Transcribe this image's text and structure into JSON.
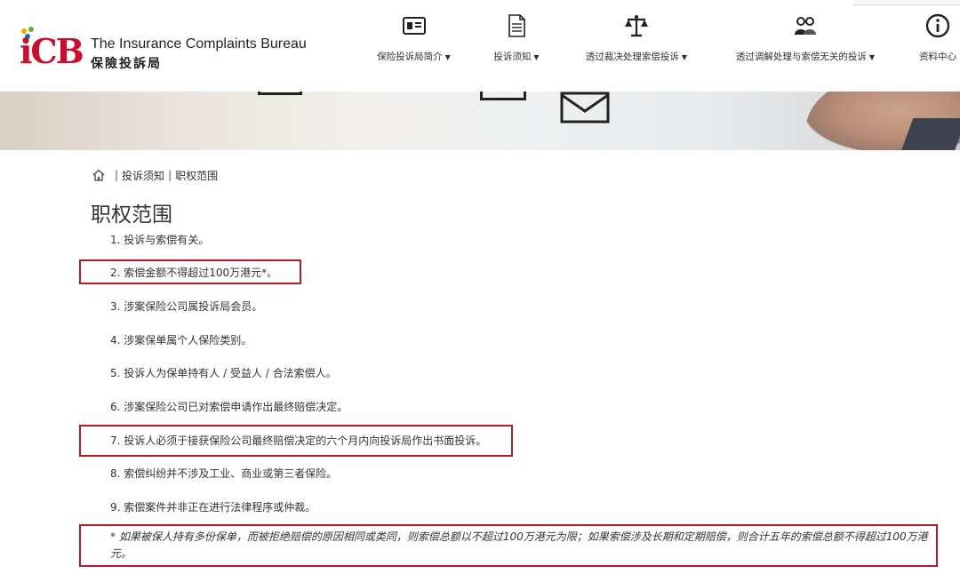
{
  "header": {
    "logo_mark": "iCB",
    "logo_en": "The Insurance Complaints Bureau",
    "logo_zh": "保險投訴局",
    "logo_dot_colors": [
      "#f2a900",
      "#6ab023",
      "#c8102e",
      "#0077c8"
    ],
    "nav": [
      {
        "icon": "id-card-icon",
        "label": "保险投诉局简介",
        "caret": "▼"
      },
      {
        "icon": "document-icon",
        "label": "投诉须知",
        "caret": "▼"
      },
      {
        "icon": "scales-icon",
        "label": "透过裁决处理索偿投诉",
        "caret": "▼"
      },
      {
        "icon": "people-icon",
        "label": "透过调解处理与索偿无关的投诉",
        "caret": "▼"
      },
      {
        "icon": "info-icon",
        "label": "资料中心",
        "caret": ""
      }
    ]
  },
  "breadcrumb": {
    "home_icon": "home-icon",
    "sep": "|",
    "section": "投诉须知",
    "current": "职权范围"
  },
  "page_title": "职权范围",
  "items": [
    "1. 投诉与索偿有关。",
    "2. 索偿金额不得超过100万港元*。",
    "3. 涉案保险公司属投诉局会员。",
    "4. 涉案保单属个人保险类别。",
    "5. 投诉人为保单持有人 / 受益人 / 合法索偿人。",
    "6. 涉案保险公司已对索偿申请作出最终赔偿决定。",
    "7. 投诉人必须于接获保险公司最终赔偿决定的六个月内向投诉局作出书面投诉。",
    "8. 索偿纠纷并不涉及工业、商业或第三者保险。",
    "9. 索偿案件并非正在进行法律程序或仲裁。"
  ],
  "footnote": "* 如果被保人持有多份保单，而被拒绝赔偿的原因相同或类同，则索偿总额以不超过100万港元为限；如果索偿涉及长期和定期赔偿，则合计五年的索偿总额不得超过100万港元。",
  "colors": {
    "accent": "#c8102e",
    "highlight": "#b01c2a"
  }
}
